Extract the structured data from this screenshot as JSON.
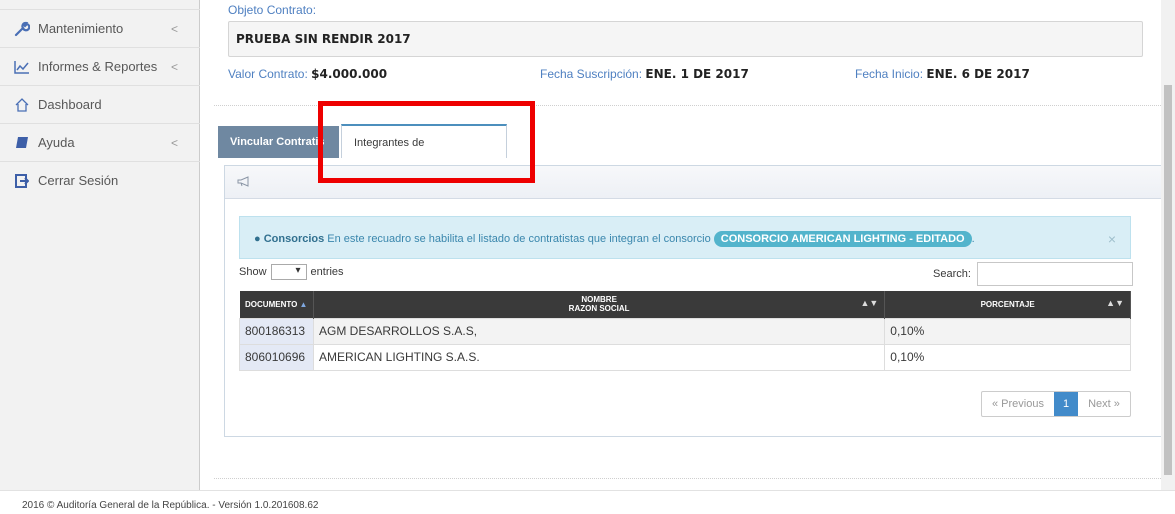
{
  "sidebar": {
    "items": [
      {
        "label": "Mantenimiento",
        "icon": "wrench-icon",
        "has_submenu": true
      },
      {
        "label": "Informes & Reportes",
        "icon": "line-chart-icon",
        "has_submenu": true
      },
      {
        "label": "Dashboard",
        "icon": "home-icon",
        "has_submenu": false
      },
      {
        "label": "Ayuda",
        "icon": "book-icon",
        "has_submenu": true
      },
      {
        "label": "Cerrar Sesión",
        "icon": "sign-out-icon",
        "has_submenu": false
      }
    ]
  },
  "contract": {
    "objeto_label": "Objeto Contrato:",
    "objeto_value": "PRUEBA SIN RENDIR 2017",
    "valor_label": "Valor Contrato:",
    "valor_value": "$4.000.000",
    "suscripcion_label": "Fecha Suscripción:",
    "suscripcion_value": "ENE. 1 DE 2017",
    "inicio_label": "Fecha Inicio:",
    "inicio_value": "ENE. 6 DE 2017"
  },
  "tabs": [
    {
      "label": "Vincular Contratis",
      "active": false
    },
    {
      "label": "Integrantes de Consorcios/UT",
      "active": true
    }
  ],
  "alert": {
    "title": "Consorcios",
    "text": "En este recuadro se habilita el listado de contratistas que integran el consorcio",
    "badge": "CONSORCIO AMERICAN LIGHTING - EDITADO",
    "trailing": ".",
    "close": "×"
  },
  "table_controls": {
    "show_label": "Show",
    "entries_label": "entries",
    "search_label": "Search:"
  },
  "table": {
    "headers": {
      "documento": "DOCUMENTO",
      "nombre_line1": "NOMBRE",
      "nombre_line2": "RAZON SOCIAL",
      "porcentaje": "PORCENTAJE"
    },
    "rows": [
      {
        "documento": "800186313",
        "nombre": "AGM DESARROLLOS S.A.S,",
        "porcentaje": "0,10%"
      },
      {
        "documento": "806010696",
        "nombre": "AMERICAN LIGHTING S.A.S.",
        "porcentaje": "0,10%"
      }
    ]
  },
  "pagination": {
    "previous": "« Previous",
    "current": "1",
    "next": "Next »"
  },
  "footer": {
    "text": "2016 © Auditoría General de la República. - Versión 1.0.201608.62"
  },
  "colors": {
    "accent": "#4f80c1",
    "highlight": "#ee0000",
    "badge": "#53b4cc",
    "pager_active": "#428bca"
  }
}
